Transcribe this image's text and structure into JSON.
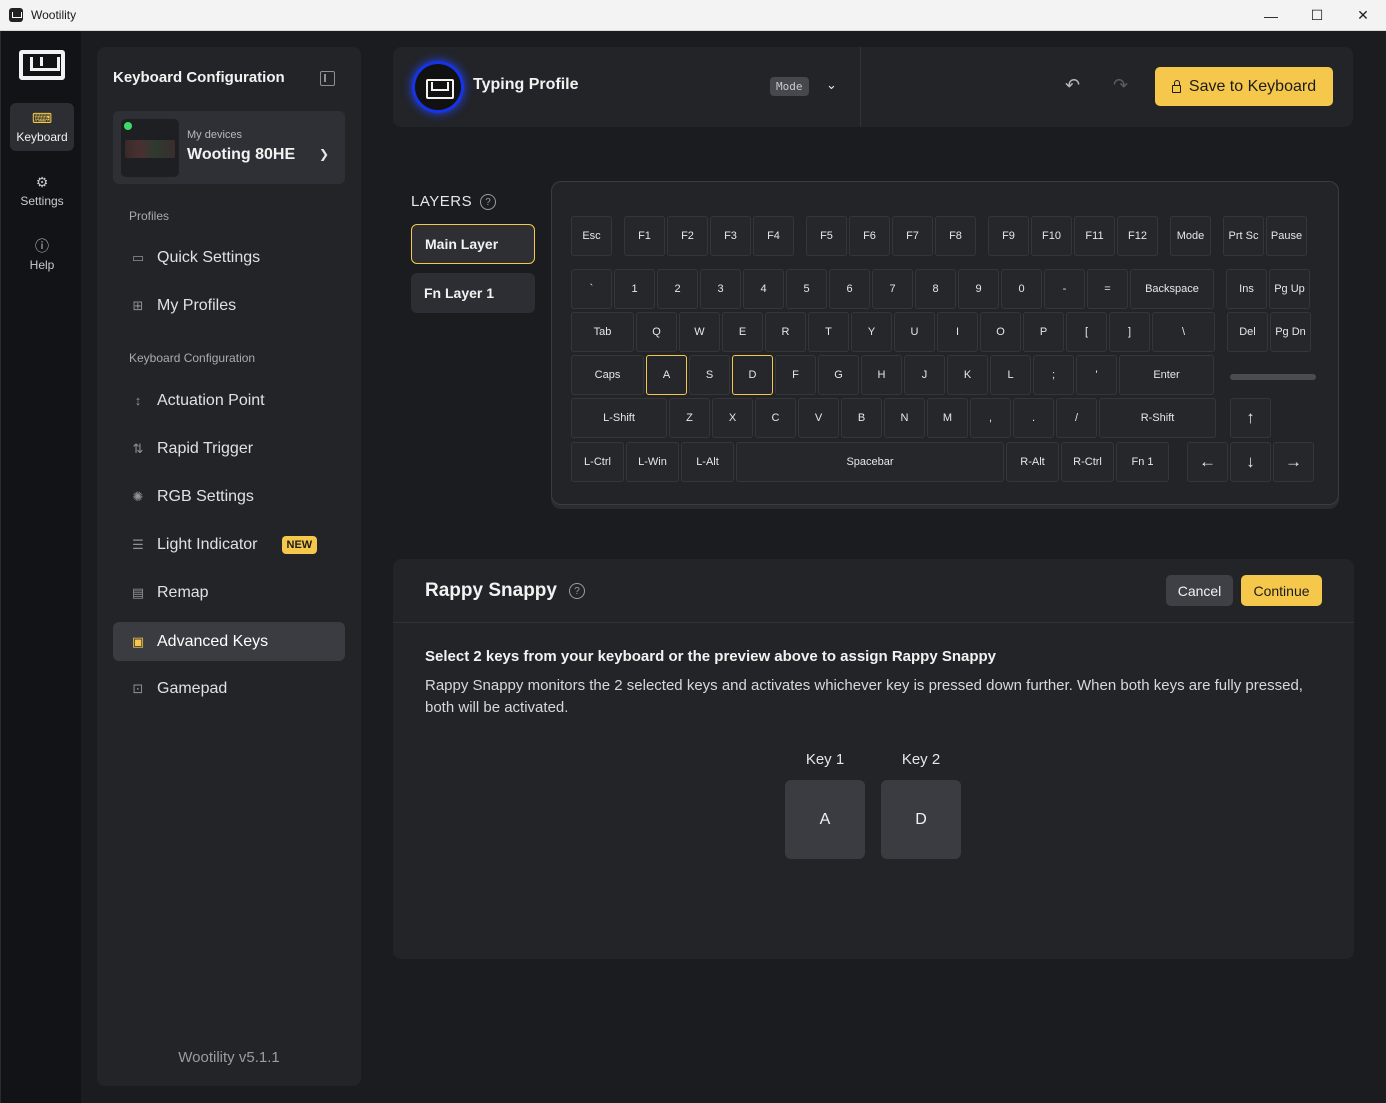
{
  "window": {
    "title": "Wootility",
    "minimize": "—",
    "maximize": "☐",
    "close": "✕"
  },
  "rail": {
    "items": [
      {
        "label": "Keyboard",
        "icon": "keyboard-icon"
      },
      {
        "label": "Settings",
        "icon": "gear-icon"
      },
      {
        "label": "Help",
        "icon": "help-icon"
      }
    ]
  },
  "sidebar": {
    "title": "Keyboard Configuration",
    "device": {
      "sub": "My devices",
      "name": "Wooting 80HE"
    },
    "section_profiles": "Profiles",
    "profiles_items": [
      "Quick Settings",
      "My Profiles"
    ],
    "section_config": "Keyboard Configuration",
    "config_items": [
      "Actuation Point",
      "Rapid Trigger",
      "RGB Settings",
      "Light Indicator",
      "Remap",
      "Advanced Keys",
      "Gamepad"
    ],
    "new_badge": "NEW",
    "version": "Wootility v5.1.1"
  },
  "topbar": {
    "profile_name": "Typing Profile",
    "mode_label": "Mode",
    "save_label": "Save to Keyboard"
  },
  "layers": {
    "title": "LAYERS",
    "items": [
      "Main Layer",
      "Fn Layer 1"
    ]
  },
  "keyboard": {
    "rows": [
      [
        "Esc",
        "F1",
        "F2",
        "F3",
        "F4",
        "F5",
        "F6",
        "F7",
        "F8",
        "F9",
        "F10",
        "F11",
        "F12",
        "Mode",
        "Prt Sc",
        "Pause"
      ],
      [
        "`",
        "1",
        "2",
        "3",
        "4",
        "5",
        "6",
        "7",
        "8",
        "9",
        "0",
        "-",
        "=",
        "Backspace",
        "Ins",
        "Pg Up"
      ],
      [
        "Tab",
        "Q",
        "W",
        "E",
        "R",
        "T",
        "Y",
        "U",
        "I",
        "O",
        "P",
        "[",
        "]",
        "\\",
        "Del",
        "Pg Dn"
      ],
      [
        "Caps",
        "A",
        "S",
        "D",
        "F",
        "G",
        "H",
        "J",
        "K",
        "L",
        ";",
        "'",
        "Enter"
      ],
      [
        "L-Shift",
        "Z",
        "X",
        "C",
        "V",
        "B",
        "N",
        "M",
        ",",
        ".",
        "/",
        "R-Shift",
        "↑"
      ],
      [
        "L-Ctrl",
        "L-Win",
        "L-Alt",
        "Spacebar",
        "R-Alt",
        "R-Ctrl",
        "Fn 1",
        "←",
        "↓",
        "→"
      ]
    ],
    "selected": [
      "A",
      "D"
    ]
  },
  "panel": {
    "title": "Rappy Snappy",
    "cancel": "Cancel",
    "continue": "Continue",
    "heading": "Select 2 keys from your keyboard or the preview above to assign Rappy Snappy",
    "description": "Rappy Snappy monitors the 2 selected keys and activates whichever key is pressed down further. When both keys are fully pressed, both will be activated.",
    "key1_label": "Key 1",
    "key1_value": "A",
    "key2_label": "Key 2",
    "key2_value": "D"
  },
  "colors": {
    "accent": "#f5c84c",
    "background": "#1b1c1f",
    "panel": "#232428",
    "status_online": "#3ddc68"
  }
}
